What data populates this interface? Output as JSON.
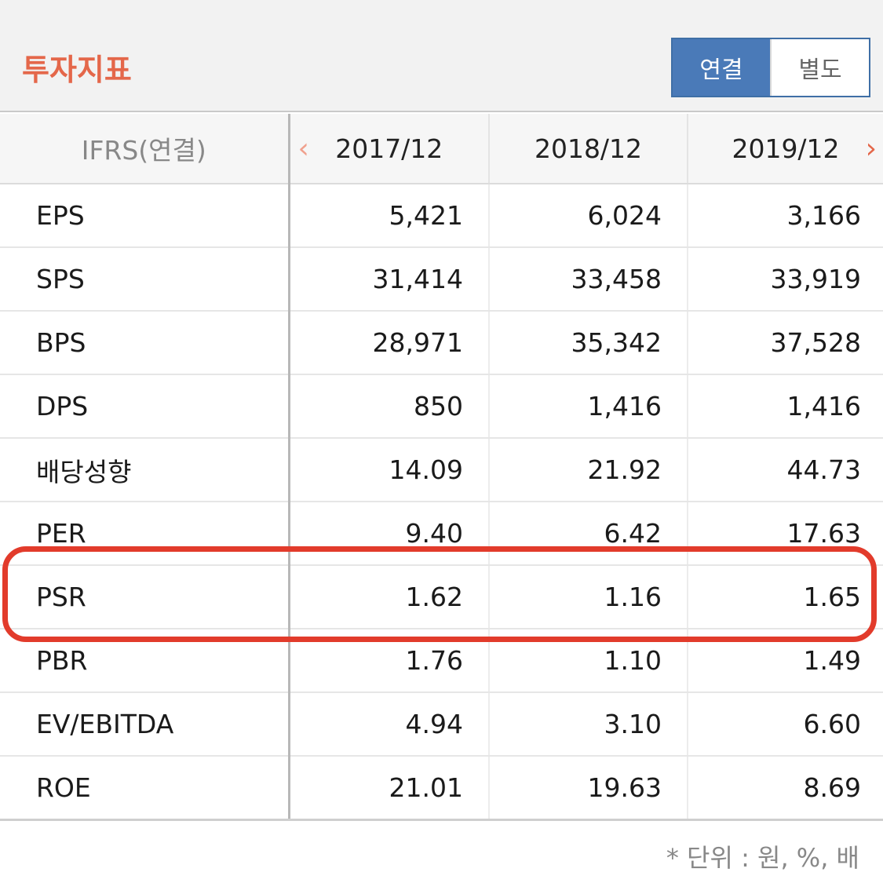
{
  "header": {
    "title": "투자지표",
    "toggle": {
      "consolidated": "연결",
      "separate": "별도",
      "active": "consolidated"
    }
  },
  "table": {
    "label_header": "IFRS(연결)",
    "columns": [
      "2017/12",
      "2018/12",
      "2019/12"
    ],
    "rows": [
      {
        "label": "EPS",
        "values": [
          "5,421",
          "6,024",
          "3,166"
        ]
      },
      {
        "label": "SPS",
        "values": [
          "31,414",
          "33,458",
          "33,919"
        ]
      },
      {
        "label": "BPS",
        "values": [
          "28,971",
          "35,342",
          "37,528"
        ]
      },
      {
        "label": "DPS",
        "values": [
          "850",
          "1,416",
          "1,416"
        ]
      },
      {
        "label": "배당성향",
        "values": [
          "14.09",
          "21.92",
          "44.73"
        ]
      },
      {
        "label": "PER",
        "values": [
          "9.40",
          "6.42",
          "17.63"
        ]
      },
      {
        "label": "PSR",
        "values": [
          "1.62",
          "1.16",
          "1.65"
        ],
        "highlighted": true
      },
      {
        "label": "PBR",
        "values": [
          "1.76",
          "1.10",
          "1.49"
        ]
      },
      {
        "label": "EV/EBITDA",
        "values": [
          "4.94",
          "3.10",
          "6.60"
        ]
      },
      {
        "label": "ROE",
        "values": [
          "21.01",
          "19.63",
          "8.69"
        ]
      }
    ]
  },
  "footnote": "* 단위 : 원, %, 배",
  "icons": {
    "prev": "chevron-left-icon",
    "next": "chevron-right-icon"
  },
  "colors": {
    "title": "#e4674a",
    "active_toggle": "#4a7ab8",
    "highlight": "#e23b2b"
  }
}
